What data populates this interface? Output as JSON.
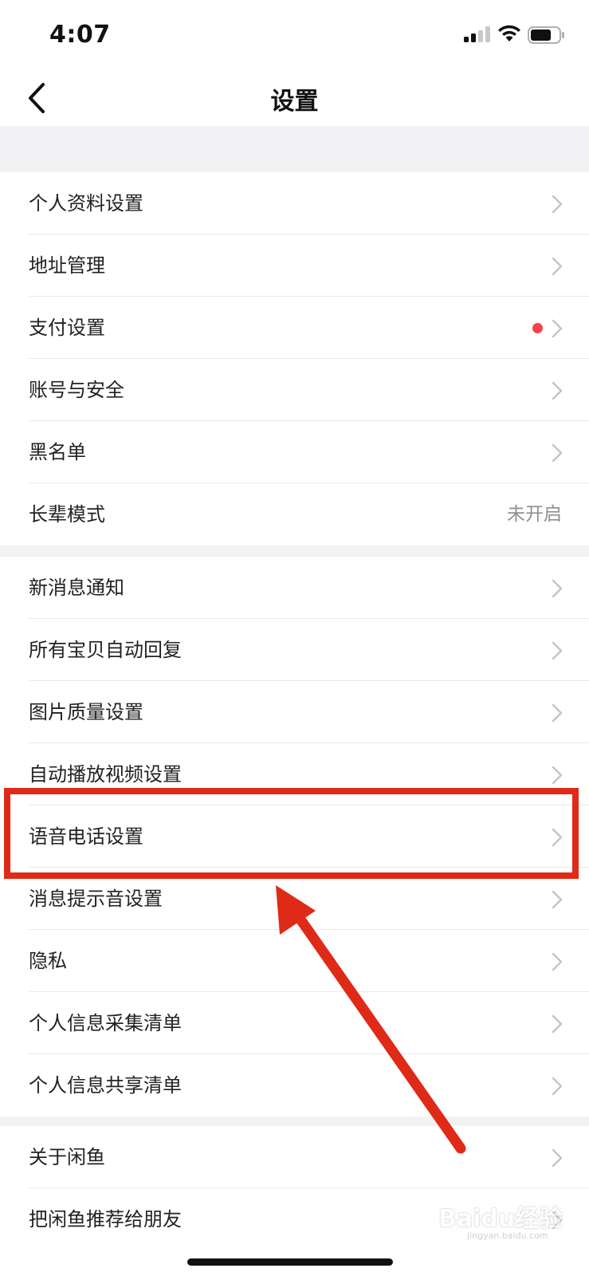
{
  "status_bar": {
    "time": "4:07"
  },
  "nav": {
    "title": "设置"
  },
  "groups": [
    {
      "items": [
        {
          "label": "个人资料设置",
          "has_chevron": true
        },
        {
          "label": "地址管理",
          "has_chevron": true
        },
        {
          "label": "支付设置",
          "has_chevron": true,
          "badge_dot": true
        },
        {
          "label": "账号与安全",
          "has_chevron": true
        },
        {
          "label": "黑名单",
          "has_chevron": true
        },
        {
          "label": "长辈模式",
          "value": "未开启"
        }
      ]
    },
    {
      "items": [
        {
          "label": "新消息通知",
          "has_chevron": true
        },
        {
          "label": "所有宝贝自动回复",
          "has_chevron": true
        },
        {
          "label": "图片质量设置",
          "has_chevron": true
        },
        {
          "label": "自动播放视频设置",
          "has_chevron": true
        },
        {
          "label": "语音电话设置",
          "has_chevron": true
        },
        {
          "label": "消息提示音设置",
          "has_chevron": true
        },
        {
          "label": "隐私",
          "has_chevron": true
        },
        {
          "label": "个人信息采集清单",
          "has_chevron": true
        },
        {
          "label": "个人信息共享清单",
          "has_chevron": true
        }
      ]
    },
    {
      "items": [
        {
          "label": "关于闲鱼",
          "has_chevron": true
        },
        {
          "label": "把闲鱼推荐给朋友",
          "has_chevron": true
        }
      ]
    }
  ],
  "watermark": {
    "text": "Baidu经验",
    "sub": "jingyan.baidu.com"
  },
  "colors": {
    "highlight": "#e02a18",
    "badge": "#f5424b",
    "background": "#f2f2f5"
  }
}
